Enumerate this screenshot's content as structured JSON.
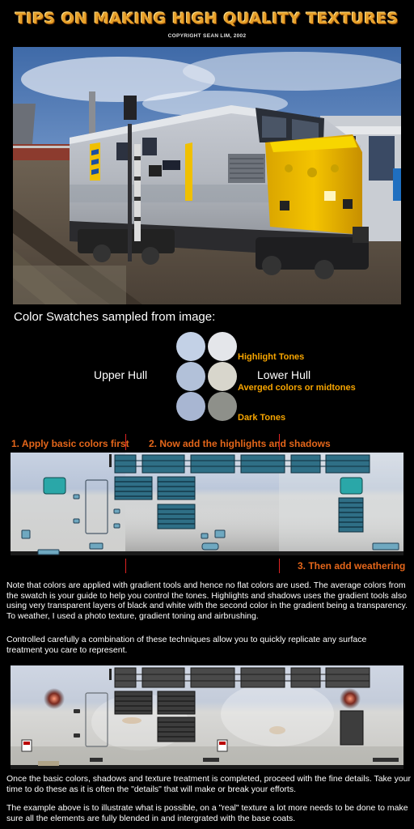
{
  "header": {
    "title": "TIPS ON MAKING HIGH QUALITY TEXTURES",
    "copyright": "COPYRIGHT SEAN LIM, 2002"
  },
  "swatches": {
    "heading": "Color Swatches sampled from image:",
    "upper_label": "Upper Hull",
    "lower_label": "Lower Hull",
    "highlight_label": "Highlight Tones",
    "midtone_label": "Averged colors or midtones",
    "dark_label": "Dark Tones",
    "colors": {
      "upper_highlight": "#c3d1e6",
      "upper_mid": "#b2c1d9",
      "upper_dark": "#a8b6d2",
      "lower_highlight": "#e4e6ea",
      "lower_mid": "#d8d6cc",
      "lower_dark": "#8e908a"
    }
  },
  "steps": {
    "step1": "1. Apply basic colors first",
    "step2": "2. Now add the highlights and shadows",
    "step3": "3. Then add weathering"
  },
  "paragraphs": {
    "p1": "Note that colors are applied with gradient tools and hence no flat colors are used. The average colors from the swatch is your guide to help you control the tones. Highlights and shadows uses the gradient tools also using very transparent layers of black and white with the second color in the gradient being a transparency. To weather, I used a photo texture, gradient toning and airbrushing.",
    "p2": "Controlled carefully a combination of these techniques allow you to quickly replicate any surface treatment you care to represent.",
    "p3": "Once the basic colors, shadows and texture treatment is completed, proceed with the fine details. Take your time to do these as it is often the \"details\" that will make or break your efforts.",
    "p4": "The example above is to illustrate what is possible, on a \"real\" texture a lot more needs to be done to make sure all the elements are fully blended in and intergrated with the base coats."
  },
  "colors": {
    "accent_orange": "#f7a500",
    "step_orange": "#e4661a",
    "guide_red": "#dd2222",
    "teal_window": "#2aa7a8"
  }
}
